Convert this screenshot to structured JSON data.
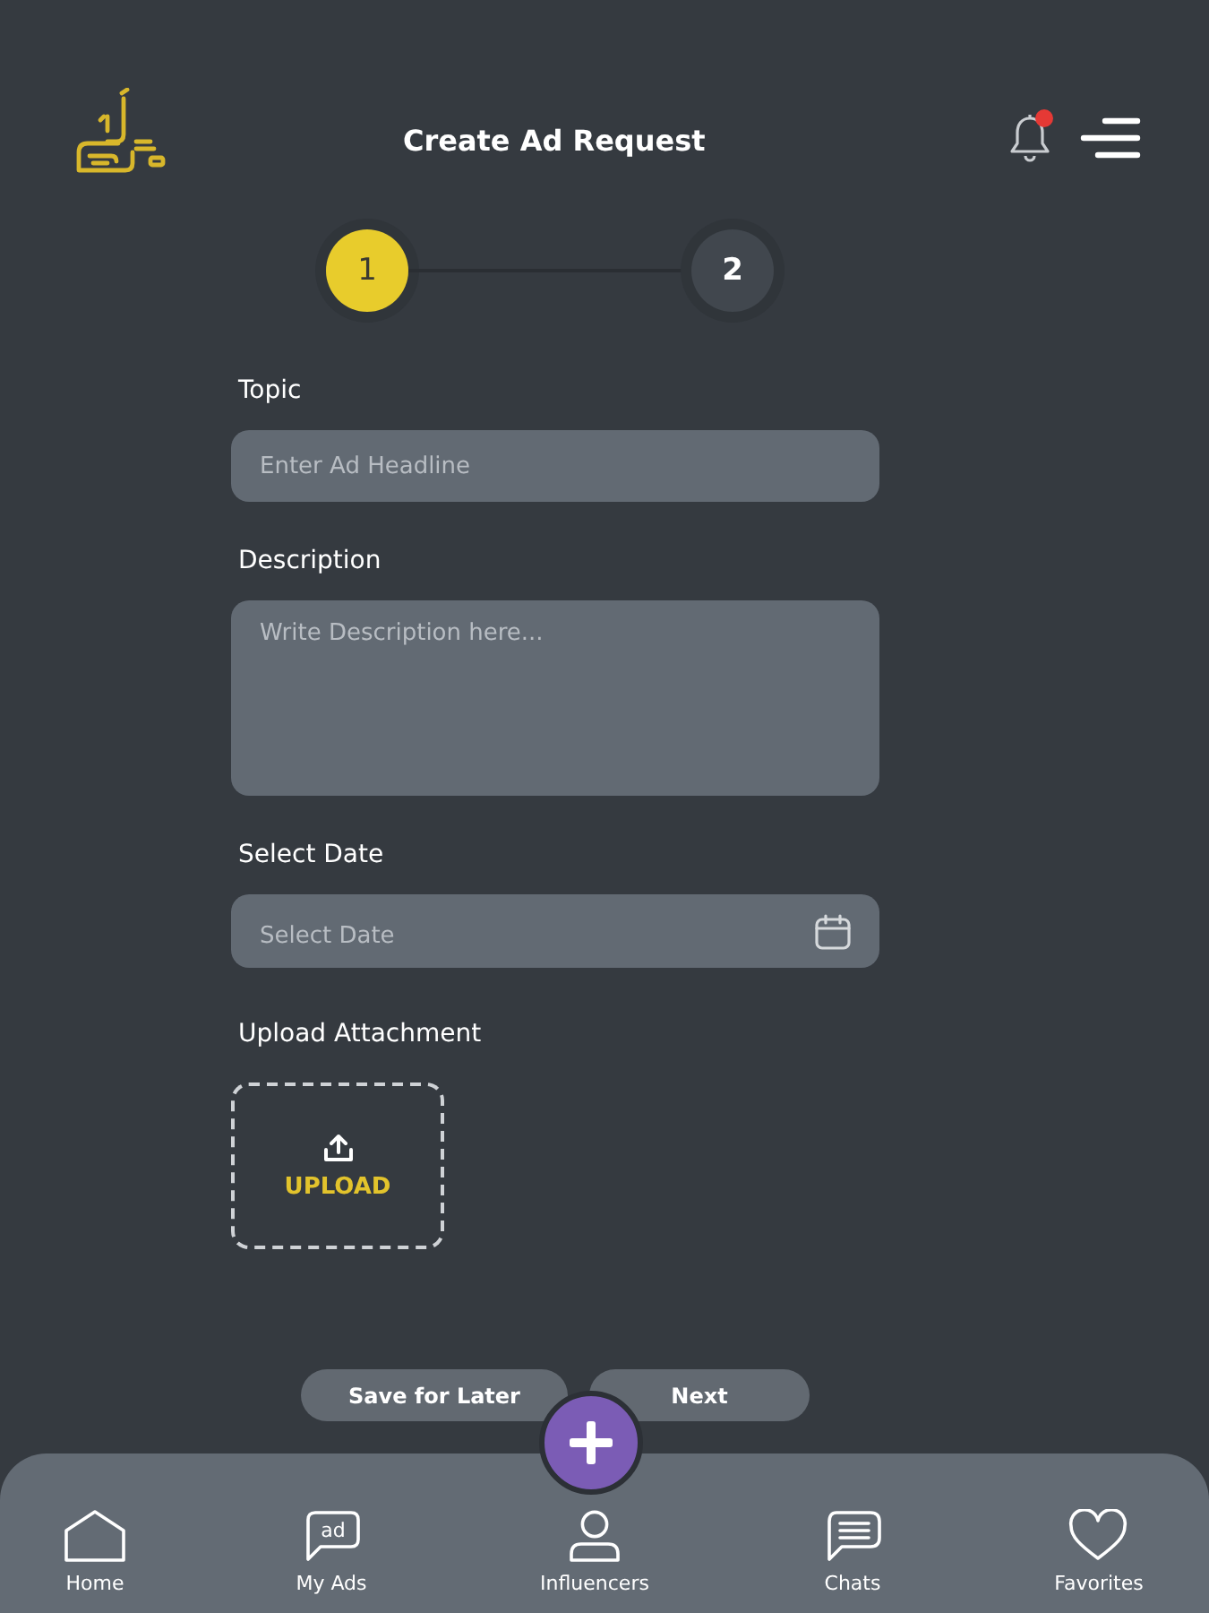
{
  "header": {
    "title": "Create Ad Request",
    "notifications_unread": true
  },
  "stepper": [
    {
      "label": "1",
      "selected": true
    },
    {
      "label": "2",
      "selected": false
    }
  ],
  "form": {
    "fields": [
      {
        "kind": "text",
        "label": "Topic",
        "placeholder": "Enter Ad Headline"
      },
      {
        "kind": "textarea",
        "label": "Description",
        "placeholder": "Write Description here..."
      },
      {
        "kind": "date",
        "label": "Select Date",
        "placeholder": "Select Date"
      },
      {
        "kind": "upload",
        "label": "Upload Attachment",
        "button": "UPLOAD"
      }
    ]
  },
  "actions": [
    "Save for Later",
    "Next"
  ],
  "bottom_nav": {
    "items": [
      {
        "kind": "home",
        "label": "Home"
      },
      {
        "kind": "ads",
        "label": "My Ads",
        "icon_text": "ad"
      },
      {
        "kind": "person",
        "label": "Influencers"
      },
      {
        "kind": "chat",
        "label": "Chats"
      },
      {
        "kind": "heart",
        "label": "Favorites"
      }
    ]
  }
}
